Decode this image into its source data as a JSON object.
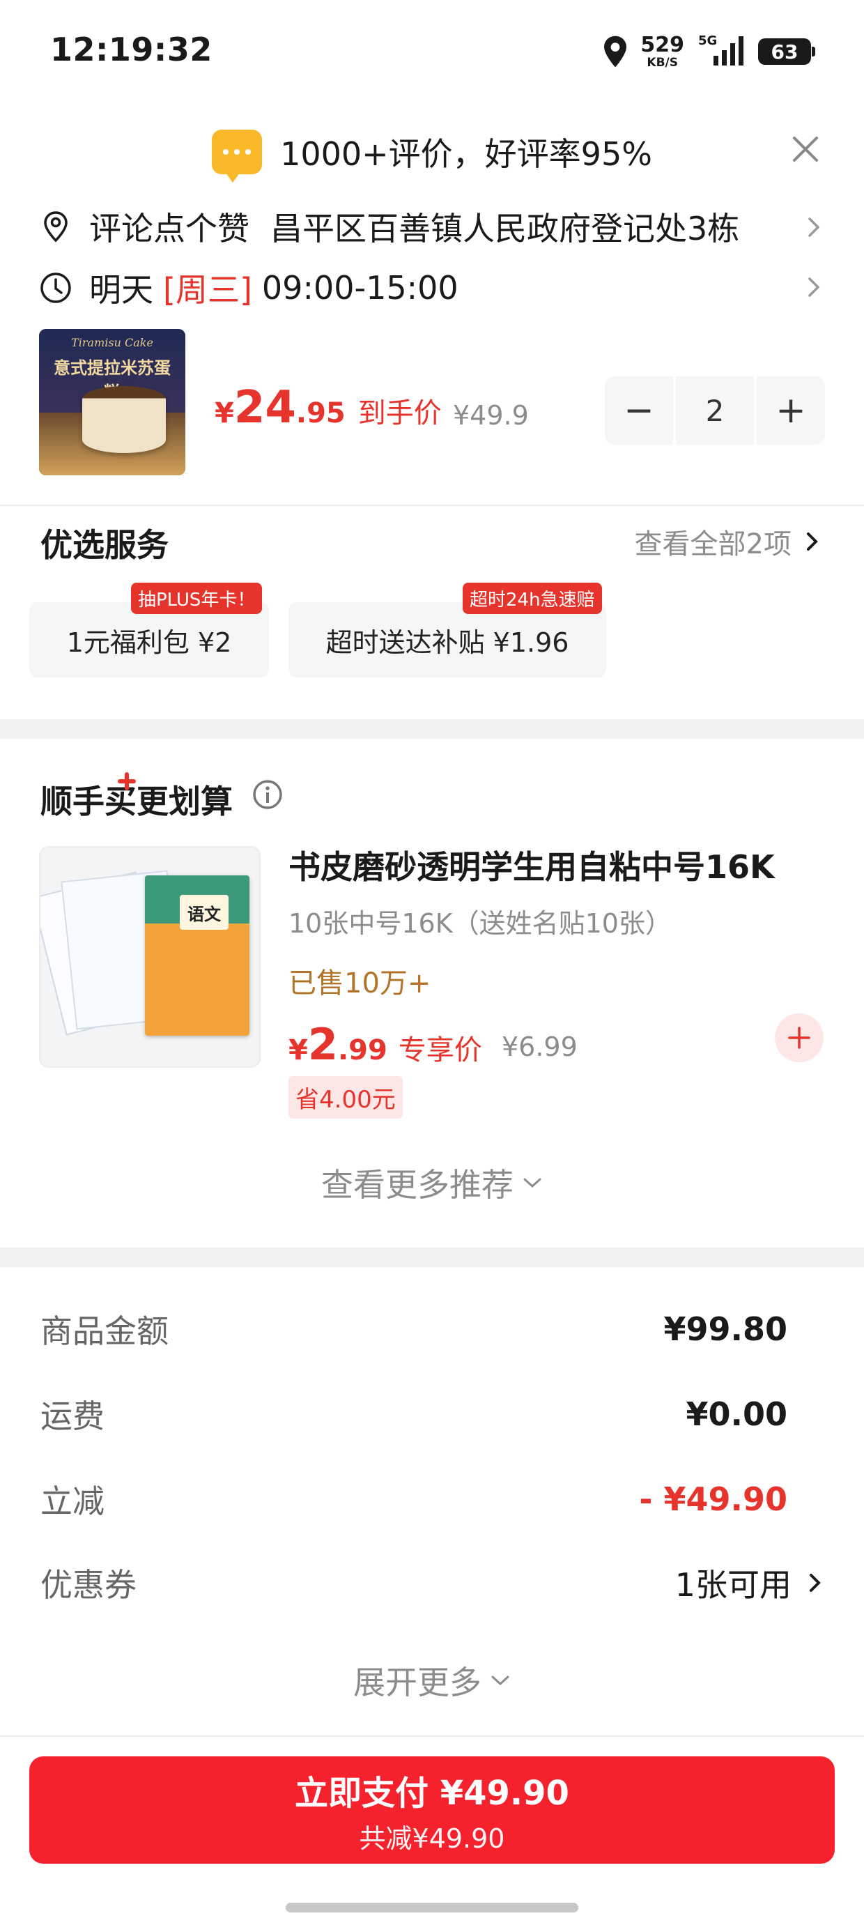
{
  "status_bar": {
    "time": "12:19:32",
    "speed_value": "529",
    "speed_unit": "KB/S",
    "network": "5G",
    "battery": "63"
  },
  "review_banner": {
    "text": "1000+评价，好评率95%"
  },
  "address": {
    "label": "评论点个赞",
    "text": "昌平区百善镇人民政府登记处3栋"
  },
  "delivery": {
    "day": "明天",
    "weekday": "[周三]",
    "time_range": "09:00-15:00"
  },
  "product": {
    "image_title": "意式提拉米苏蛋糕",
    "image_subtitle": "Tiramisu Cake",
    "currency": "¥",
    "price_int": "24",
    "price_dec": ".95",
    "price_label": "到手价",
    "original_price": "¥49.9",
    "quantity": "2",
    "minus": "−",
    "plus": "+"
  },
  "services": {
    "title": "优选服务",
    "see_all": "查看全部2项",
    "items": [
      {
        "tag": "抽PLUS年卡！",
        "label": "1元福利包  ¥2"
      },
      {
        "tag": "超时24h急速赔",
        "label": "超时送达补贴  ¥1.96"
      }
    ]
  },
  "cross_sell": {
    "title": "顺手买更划算",
    "item": {
      "name": "书皮磨砂透明学生用自粘中号16K",
      "subtitle": "10张中号16K（送姓名贴10张）",
      "sold": "已售10万+",
      "currency": "¥",
      "price_int": "2",
      "price_dec": ".99",
      "price_label": "专享价",
      "original_price": "¥6.99",
      "save": "省4.00元",
      "book_label": "语文"
    },
    "more": "查看更多推荐"
  },
  "summary": {
    "rows": [
      {
        "label": "商品金额",
        "value": "¥99.80"
      },
      {
        "label": "运费",
        "value": "¥0.00"
      },
      {
        "label": "立减",
        "value": "- ¥49.90"
      },
      {
        "label": "优惠券",
        "value": "1张可用"
      }
    ],
    "expand": "展开更多"
  },
  "pay": {
    "main": "立即支付 ¥49.90",
    "sub": "共减¥49.90"
  },
  "colors": {
    "accent_red": "#e6342c",
    "pay_red": "#f5222d",
    "gold": "#b3742a",
    "banner_icon": "#f9b72a"
  }
}
